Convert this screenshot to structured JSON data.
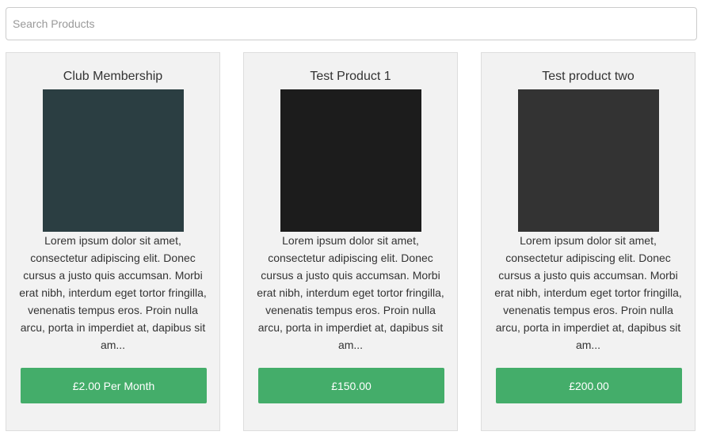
{
  "search": {
    "placeholder": "Search Products",
    "value": ""
  },
  "products": [
    {
      "title": "Club Membership",
      "image_color": "#2b3e42",
      "description": "Lorem ipsum dolor sit amet, consectetur adipiscing elit. Donec cursus a justo quis accumsan. Morbi erat nibh, interdum eget tortor fringilla, venenatis tempus eros. Proin nulla arcu, porta in imperdiet at, dapibus sit am...",
      "price_label": "£2.00 Per Month"
    },
    {
      "title": "Test Product 1",
      "image_color": "#1c1c1c",
      "description": "Lorem ipsum dolor sit amet, consectetur adipiscing elit. Donec cursus a justo quis accumsan. Morbi erat nibh, interdum eget tortor fringilla, venenatis tempus eros. Proin nulla arcu, porta in imperdiet at, dapibus sit am...",
      "price_label": "£150.00"
    },
    {
      "title": "Test product two",
      "image_color": "#333333",
      "description": "Lorem ipsum dolor sit amet, consectetur adipiscing elit. Donec cursus a justo quis accumsan. Morbi erat nibh, interdum eget tortor fringilla, venenatis tempus eros. Proin nulla arcu, porta in imperdiet at, dapibus sit am...",
      "price_label": "£200.00"
    }
  ],
  "colors": {
    "button": "#44ad6a",
    "card_background": "#f2f2f2"
  }
}
